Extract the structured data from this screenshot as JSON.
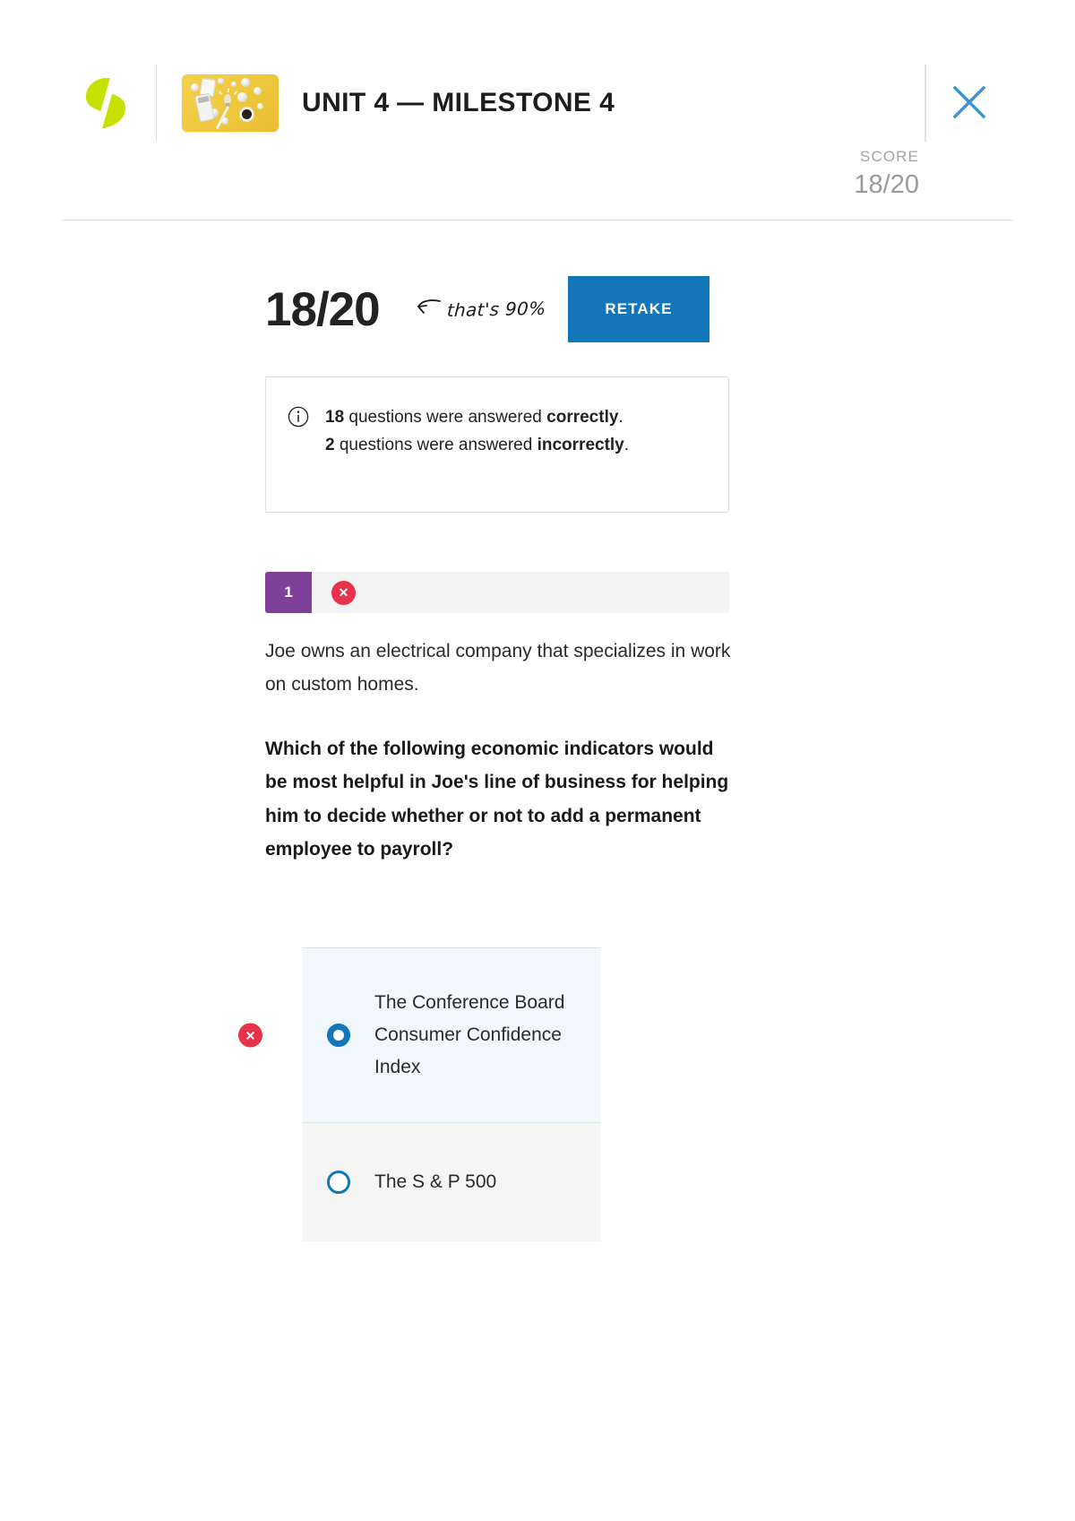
{
  "header": {
    "brand_logo_icon": "sophia-leaf-logo",
    "unit_thumbnail_icon": "unit-cover-thumbnail",
    "title": "UNIT 4 — MILESTONE 4",
    "close_icon": "close-icon",
    "score_label": "SCORE",
    "score_value": "18/20"
  },
  "result": {
    "big_score": "18/20",
    "annotation": "that's 90%",
    "annotation_arrow_icon": "curved-left-arrow-icon",
    "retake_label": "RETAKE",
    "retake_color": "#1276b8"
  },
  "info_box": {
    "icon": "info-circle-icon",
    "line1_count": "18",
    "line1_mid": " questions were answered ",
    "line1_emphasis": "correctly",
    "line1_end": ".",
    "line2_count": "2",
    "line2_mid": " questions were answered ",
    "line2_emphasis": "incorrectly",
    "line2_end": "."
  },
  "question": {
    "number": "1",
    "status_icon": "incorrect-x-icon",
    "status_color": "#e8314a",
    "number_badge_color": "#7e4199",
    "intro": "Joe owns an electrical company that specializes in work on custom homes.",
    "prompt": "Which of the following economic indicators would be most helpful in Joe's line of business for helping him to decide whether or not to add a permanent employee to payroll?",
    "answers": [
      {
        "label": "The Conference Board Consumer Confidence Index",
        "selected": true,
        "marked_incorrect": true,
        "radio_icon": "radio-checked-icon",
        "mark_icon": "incorrect-x-icon"
      },
      {
        "label": "The S & P 500",
        "selected": false,
        "marked_incorrect": false,
        "radio_icon": "radio-unchecked-icon",
        "mark_icon": ""
      }
    ]
  }
}
